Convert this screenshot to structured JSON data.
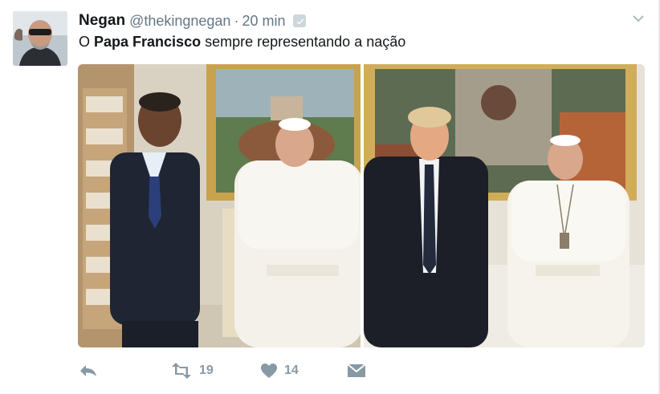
{
  "tweet": {
    "display_name": "Negan",
    "handle": "@thekingnegan",
    "separator": "·",
    "time": "20 min",
    "text_prefix": "O ",
    "text_bold": "Papa Francisco",
    "text_suffix": " sempre representando a nação"
  },
  "actions": {
    "reply_icon": "reply-arrow-icon",
    "retweet_icon": "retweet-icon",
    "retweet_count": "19",
    "like_icon": "heart-icon",
    "like_count": "14",
    "message_icon": "direct-message-icon"
  },
  "colors": {
    "text": "#14171a",
    "muted": "#657786",
    "action": "#8899a6"
  }
}
